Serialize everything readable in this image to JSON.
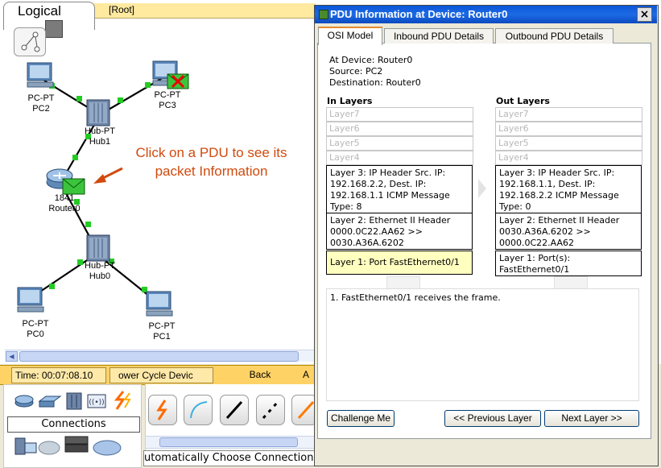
{
  "workspace": {
    "tab_label": "Logical",
    "root_label": "[Root]",
    "annotation_line1": "Click on a PDU to see its",
    "annotation_line2": "packet Information"
  },
  "devices": [
    {
      "type": "PC-PT",
      "name": "PC2"
    },
    {
      "type": "PC-PT",
      "name": "PC3"
    },
    {
      "type": "Hub-PT",
      "name": "Hub1"
    },
    {
      "type": "1841",
      "name": "Router0"
    },
    {
      "type": "Hub-PT",
      "name": "Hub0"
    },
    {
      "type": "PC-PT",
      "name": "PC0"
    },
    {
      "type": "PC-PT",
      "name": "PC1"
    }
  ],
  "bottom": {
    "time": "Time: 00:07:08.10",
    "power_cycle": "ower Cycle Devic",
    "back": "Back",
    "more": "A",
    "connections_label": "Connections",
    "auto_connection": "utomatically Choose Connection Ty"
  },
  "dialog": {
    "title": "PDU Information at Device: Router0",
    "close": "×",
    "tabs": [
      "OSI Model",
      "Inbound PDU Details",
      "Outbound PDU Details"
    ],
    "at_device": "At Device: Router0",
    "source": "Source: PC2",
    "destination": "Destination: Router0",
    "in_layers_head": "In Layers",
    "out_layers_head": "Out Layers",
    "in_layers": [
      "Layer7",
      "Layer6",
      "Layer5",
      "Layer4",
      "Layer 3: IP Header Src. IP: 192.168.2.2, Dest. IP: 192.168.1.1 ICMP Message Type: 8",
      "Layer 2: Ethernet II Header 0000.0C22.AA62 >> 0030.A36A.6202",
      "Layer 1: Port FastEthernet0/1"
    ],
    "out_layers": [
      "Layer7",
      "Layer6",
      "Layer5",
      "Layer4",
      "Layer 3: IP Header Src. IP: 192.168.1.1, Dest. IP: 192.168.2.2 ICMP Message Type: 0",
      "Layer 2: Ethernet II Header 0030.A36A.6202 >> 0000.0C22.AA62",
      "Layer 1: Port(s): FastEthernet0/1"
    ],
    "description": "1. FastEthernet0/1 receives the frame.",
    "challenge_button": "Challenge Me",
    "prev_button": "<< Previous Layer",
    "next_button": "Next Layer >>"
  },
  "colors": {
    "accent_orange": "#d04a0d",
    "link_green": "#22cc22",
    "selected_layer_bg": "#ffffc0",
    "title_bar_blue": "#0a56d8",
    "timebar_yellow": "#ffd266"
  }
}
